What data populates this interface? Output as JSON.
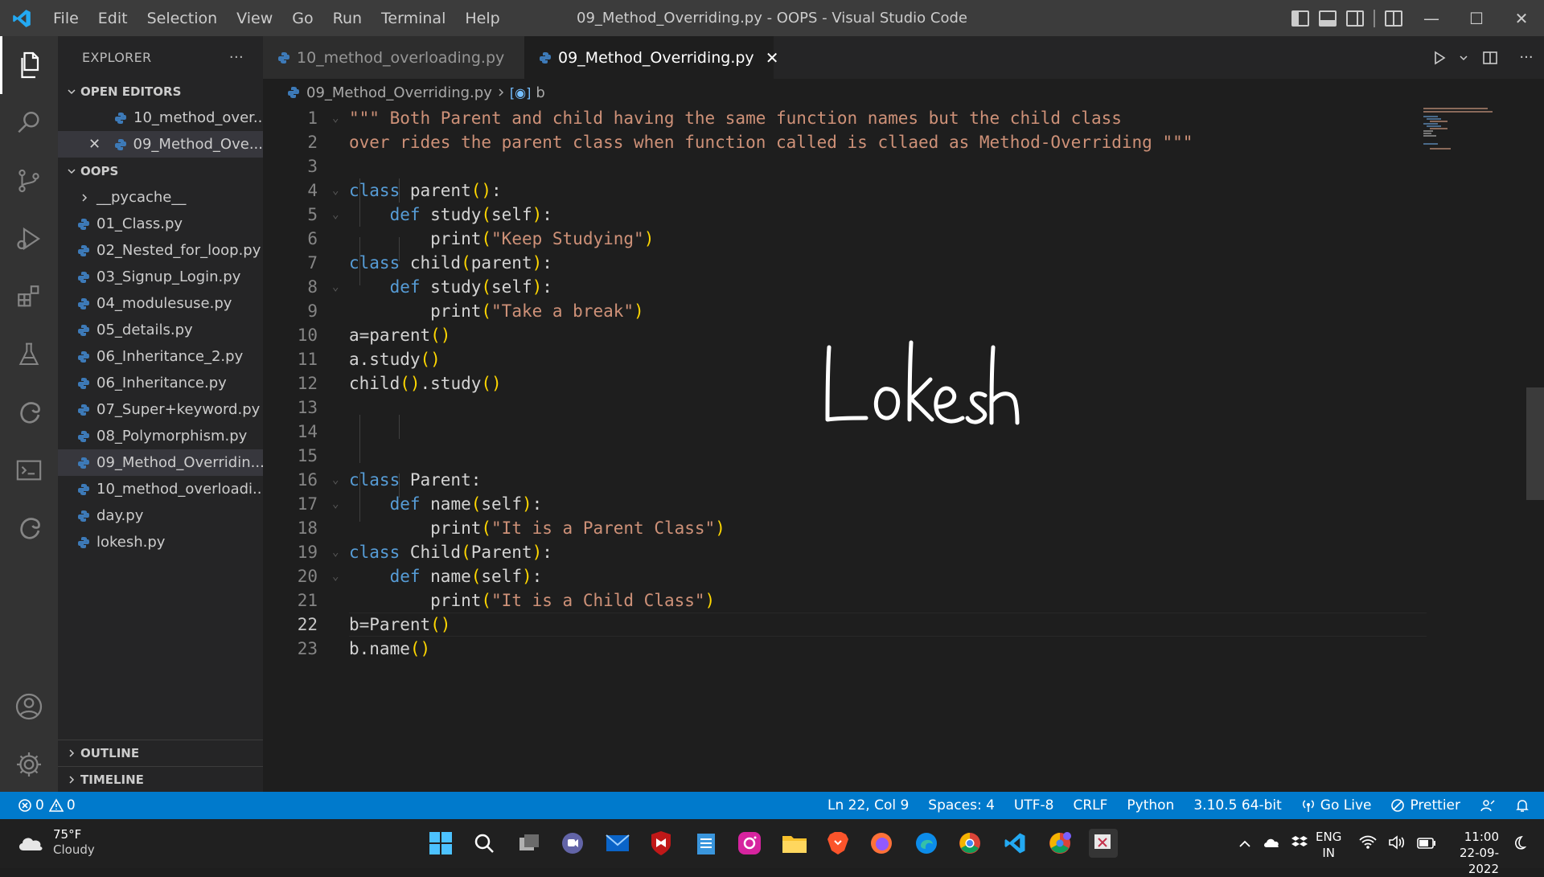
{
  "titlebar": {
    "menu": [
      "File",
      "Edit",
      "Selection",
      "View",
      "Go",
      "Run",
      "Terminal",
      "Help"
    ],
    "window_title": "09_Method_Overriding.py - OOPS - Visual Studio Code"
  },
  "sidebar": {
    "header": "EXPLORER",
    "more": "···",
    "open_editors_title": "OPEN EDITORS",
    "open_editors": [
      "10_method_over...",
      "09_Method_Ove..."
    ],
    "folder_title": "OOPS",
    "folder_items": [
      "__pycache__",
      "01_Class.py",
      "02_Nested_for_loop.py",
      "03_Signup_Login.py",
      "04_modulesuse.py",
      "05_details.py",
      "06_Inheritance_2.py",
      "06_Inheritance.py",
      "07_Super+keyword.py",
      "08_Polymorphism.py",
      "09_Method_Overridin...",
      "10_method_overloadi...",
      "day.py",
      "lokesh.py"
    ],
    "outline": "OUTLINE",
    "timeline": "TIMELINE"
  },
  "tabs": [
    {
      "label": "10_method_overloading.py"
    },
    {
      "label": "09_Method_Overriding.py"
    }
  ],
  "breadcrumb": {
    "file": "09_Method_Overriding.py",
    "symbol": "b"
  },
  "editor": {
    "line_numbers": [
      "1",
      "2",
      "3",
      "4",
      "5",
      "6",
      "7",
      "8",
      "9",
      "10",
      "11",
      "12",
      "13",
      "14",
      "15",
      "16",
      "17",
      "18",
      "19",
      "20",
      "21",
      "22",
      "23"
    ],
    "handwriting": "Lokesh",
    "code_text": {
      "l1": "\"\"\" Both Parent and child having the same function names but the child class",
      "l2": "over rides the parent class when function called is cllaed as Method-Overriding \"\"\"",
      "kw_class": "class",
      "kw_def": "def",
      "l4_name": " parent",
      "l5_name": " study",
      "self": "self",
      "print": "print",
      "s6": "\"Keep Studying\"",
      "l7_name": " child",
      "parent_arg": "parent",
      "s9": "\"Take a break\"",
      "l10": "a=parent",
      "l11": "a.study",
      "l12a": "child",
      "l12b": ".study",
      "l16": " Parent:",
      "l17_name": " name",
      "s18": "\"It is a Parent Class\"",
      "l19": " Child",
      "Parent_arg": "Parent",
      "s21": "\"It is a Child Class\"",
      "l22": "b=Parent",
      "l23": "b.name"
    }
  },
  "statusbar": {
    "errors": "0",
    "warnings": "0",
    "position": "Ln 22, Col 9",
    "spaces": "Spaces: 4",
    "encoding": "UTF-8",
    "eol": "CRLF",
    "language": "Python",
    "interpreter": "3.10.5 64-bit",
    "golive": "Go Live",
    "prettier": "Prettier"
  },
  "taskbar": {
    "temp": "75°F",
    "weather": "Cloudy",
    "lang1": "ENG",
    "lang2": "IN",
    "time": "11:00",
    "date": "22-09-2022"
  },
  "colors": {
    "accent": "#007acc",
    "keyword": "#569cd6",
    "string": "#ce9178",
    "function": "#dcdcaa",
    "bracket": "#ffd700"
  }
}
